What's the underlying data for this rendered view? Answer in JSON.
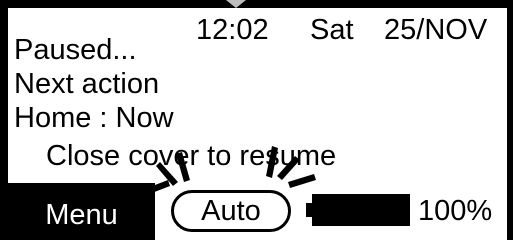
{
  "status": {
    "time": "12:02",
    "day": "Sat",
    "date": "25/NOV"
  },
  "messages": {
    "line1": "Paused...",
    "line2": "Next action",
    "line3": "Home : Now",
    "line4": "Close cover to resume"
  },
  "softkeys": {
    "menu_label": "Menu",
    "mode_label": "Auto"
  },
  "battery": {
    "level_percent": 100,
    "label": "100%"
  }
}
